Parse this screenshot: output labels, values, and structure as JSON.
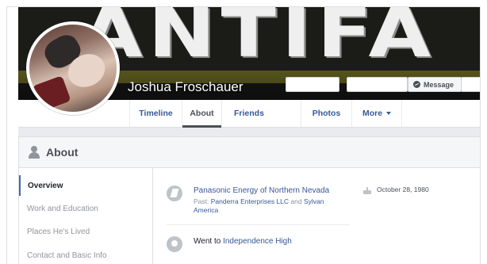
{
  "cover": {
    "word": "ANTIFA"
  },
  "profile": {
    "name": "Joshua Froschauer",
    "message_label": "Message"
  },
  "tabs": [
    {
      "label": "Timeline"
    },
    {
      "label": "About"
    },
    {
      "label": "Friends"
    },
    {
      "label": "Photos"
    },
    {
      "label": "More"
    }
  ],
  "about": {
    "title": "About",
    "nav": [
      {
        "label": "Overview"
      },
      {
        "label": "Work and Education"
      },
      {
        "label": "Places He's Lived"
      },
      {
        "label": "Contact and Basic Info"
      }
    ],
    "work": {
      "employer": "Panasonic Energy of Northern Nevada",
      "past_prefix": "Past:",
      "past_1": "Panderra Enterprises LLC",
      "past_and": "and",
      "past_2": "Sylvan America"
    },
    "education": {
      "prefix": "Went to",
      "school": "Independence High"
    },
    "birthday": "October 28, 1980"
  },
  "colors": {
    "link": "#385898",
    "accent": "#4267b2",
    "muted": "#90949c"
  }
}
